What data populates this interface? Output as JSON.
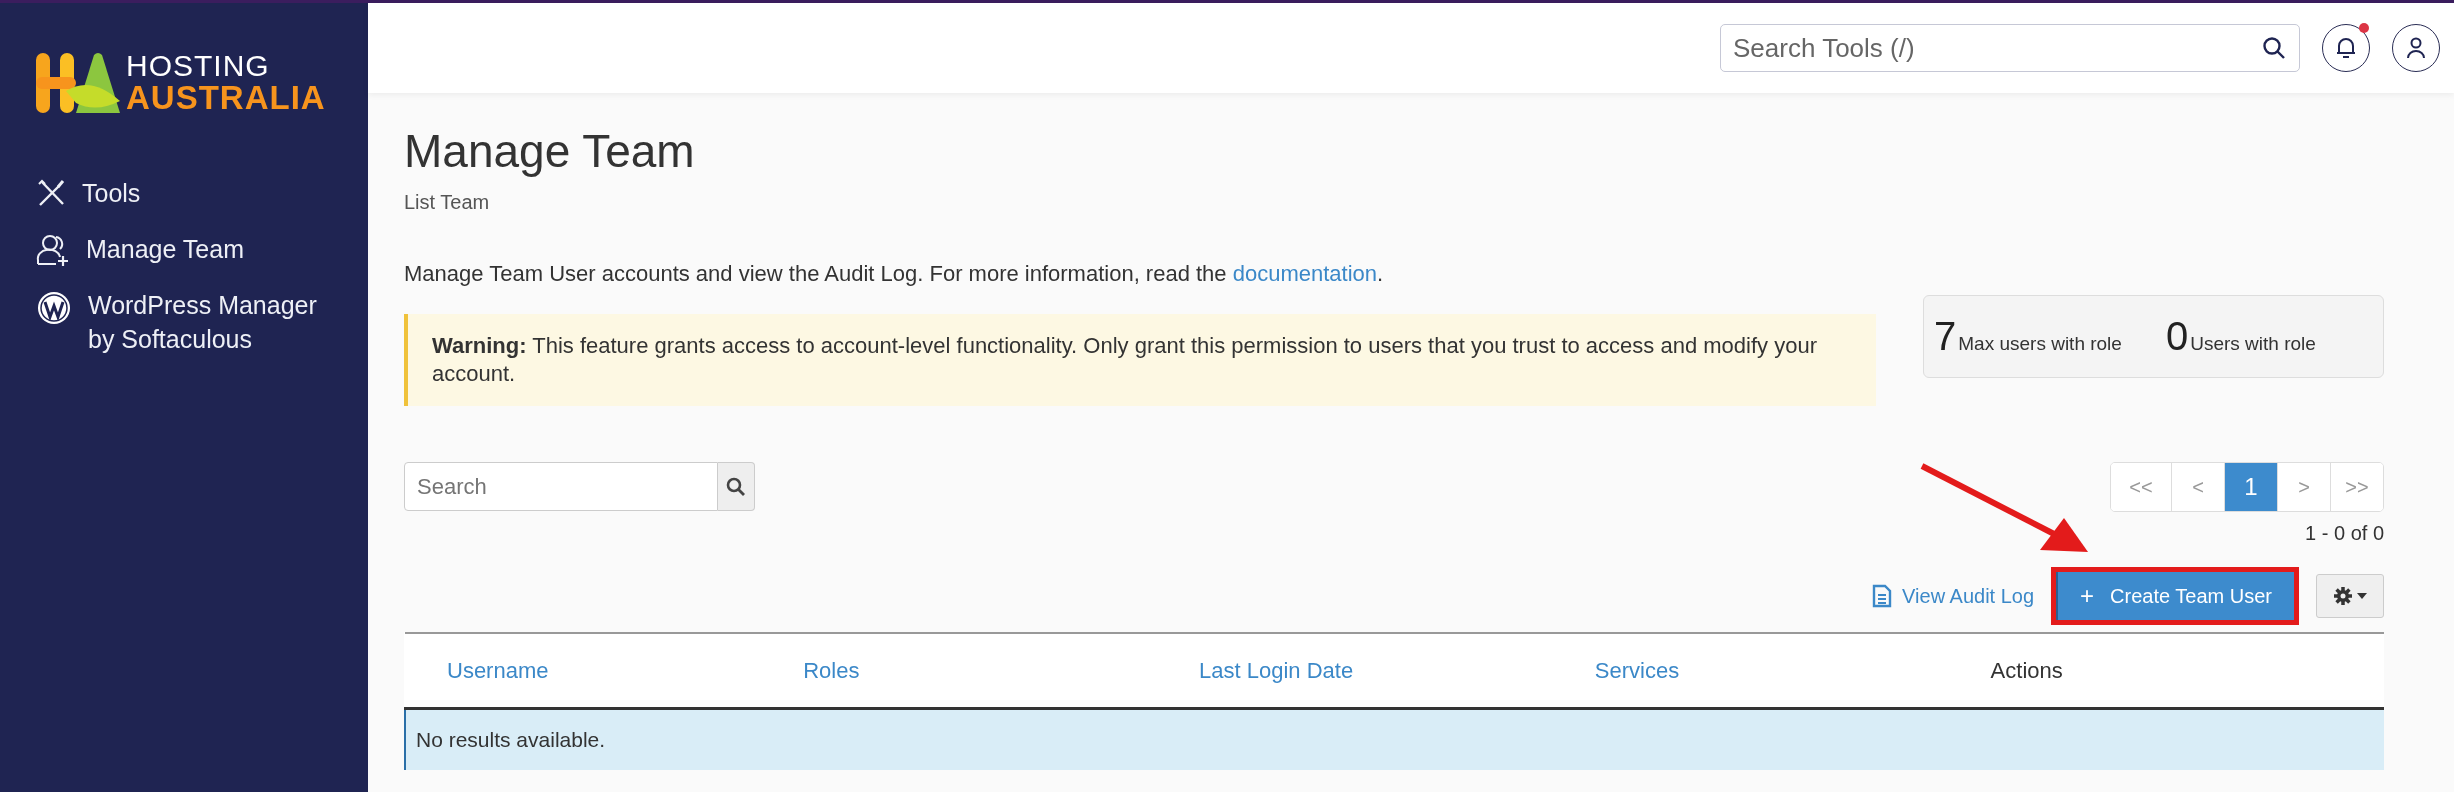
{
  "brand": {
    "line1": "HOSTING",
    "line2": "AUSTRALIA"
  },
  "sidebar": {
    "items": [
      {
        "kind": "tools",
        "label": "Tools"
      },
      {
        "kind": "team",
        "label": "Manage Team"
      },
      {
        "kind": "wordpress",
        "label": "WordPress Manager by Softaculous"
      }
    ]
  },
  "header": {
    "search": {
      "placeholder": "Search Tools (/)"
    },
    "notifications": {
      "unread": true
    }
  },
  "page": {
    "title": "Manage Team",
    "subtitle": "List Team",
    "description": "Manage Team User accounts and view the Audit Log. For more information, read the",
    "link": "documentation",
    "description_end": ".",
    "warning": "**Warning:** This feature grants access to account-level functionality. Only grant this permission to users that you trust to access and modify your account.",
    "stats": [
      {
        "value": "7",
        "label": "Max users with role"
      },
      {
        "value": "0",
        "label": "Users with role"
      }
    ],
    "search": {
      "placeholder": "Search"
    },
    "pagination": {
      "pages": [
        {
          "label": "<<",
          "selected": false
        },
        {
          "label": "<",
          "selected": false
        },
        {
          "label": "1",
          "selected": true
        },
        {
          "label": ">",
          "selected": false
        },
        {
          "label": ">>",
          "selected": false
        }
      ],
      "count": "1 - 0 of 0"
    },
    "toolbar": {
      "audit_link": "View Audit Log",
      "create_button": {
        "icon": "+",
        "label": "Create Team User",
        "highlighted": true
      }
    },
    "table": {
      "columns": [
        {
          "label": "Username",
          "sortable": true
        },
        {
          "label": "Roles",
          "sortable": true
        },
        {
          "label": "Last Login Date",
          "sortable": true
        },
        {
          "label": "Services",
          "sortable": true
        },
        {
          "label": "Actions",
          "sortable": false
        }
      ],
      "empty_message": "No results available."
    }
  }
}
